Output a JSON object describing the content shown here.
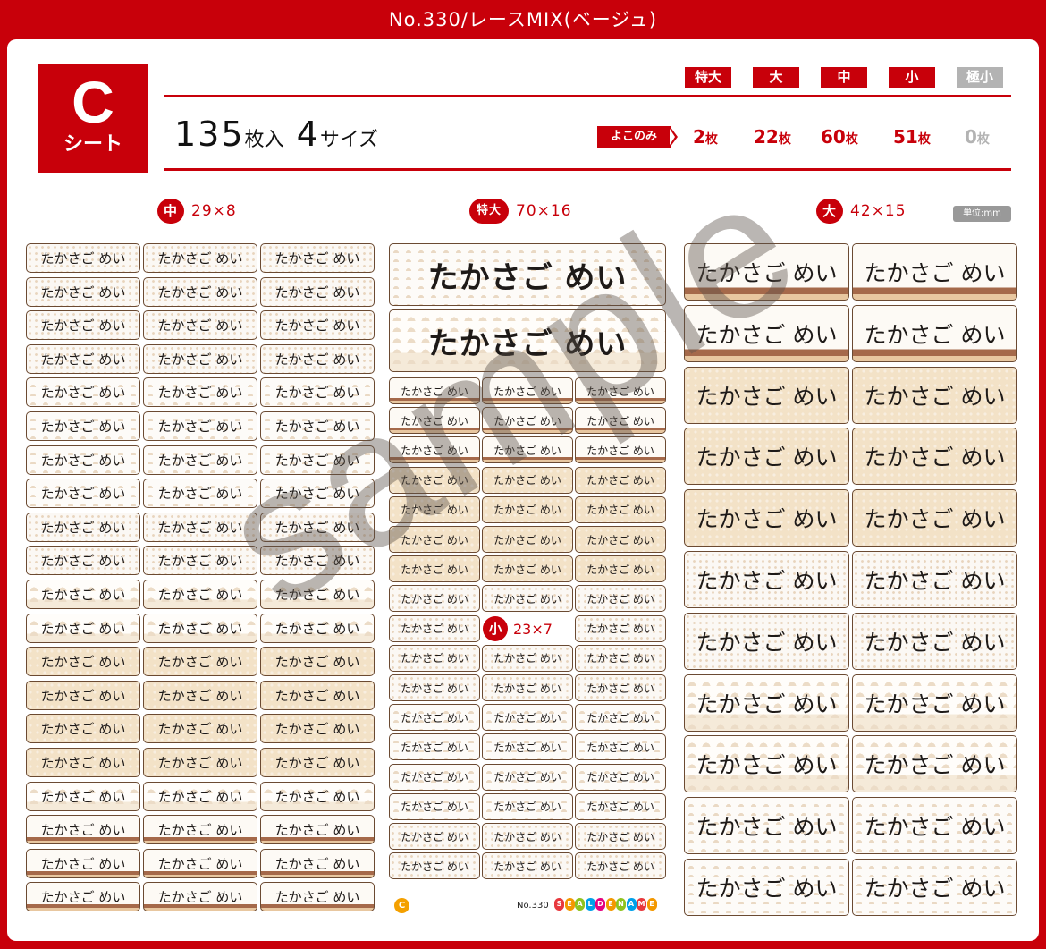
{
  "header": {
    "title": "No.330/レースMIX(ベージュ)"
  },
  "sheet_badge": {
    "letter": "C",
    "label": "シート"
  },
  "summary": {
    "count": "135",
    "count_unit": "枚入",
    "sizes": "4",
    "sizes_unit": "サイズ"
  },
  "size_chips": [
    {
      "label": "特大",
      "qty": "2",
      "disabled": false
    },
    {
      "label": "大",
      "qty": "22",
      "disabled": false
    },
    {
      "label": "中",
      "qty": "60",
      "disabled": false
    },
    {
      "label": "小",
      "qty": "51",
      "disabled": false
    },
    {
      "label": "極小",
      "qty": "0",
      "disabled": true
    }
  ],
  "qty_unit": "枚",
  "yoko_label": "よこのみ",
  "sections": {
    "mid": {
      "badge": "中",
      "dims": "29×8"
    },
    "tokudai": {
      "badge": "特大",
      "dims": "70×16"
    },
    "dai": {
      "badge": "大",
      "dims": "42×15"
    },
    "small": {
      "badge": "小",
      "dims": "23×7"
    }
  },
  "unit_note": "単位:mm",
  "label_name": "たかさご めい",
  "watermark": "sample",
  "footer": {
    "sheet_letter": "C",
    "number": "No.330",
    "brand": "SEALDENAME"
  },
  "colors": {
    "accent": "#c8000a",
    "border": "#6b4a32",
    "beige": "#f3e2c7",
    "disabled": "#b3b3b3"
  }
}
